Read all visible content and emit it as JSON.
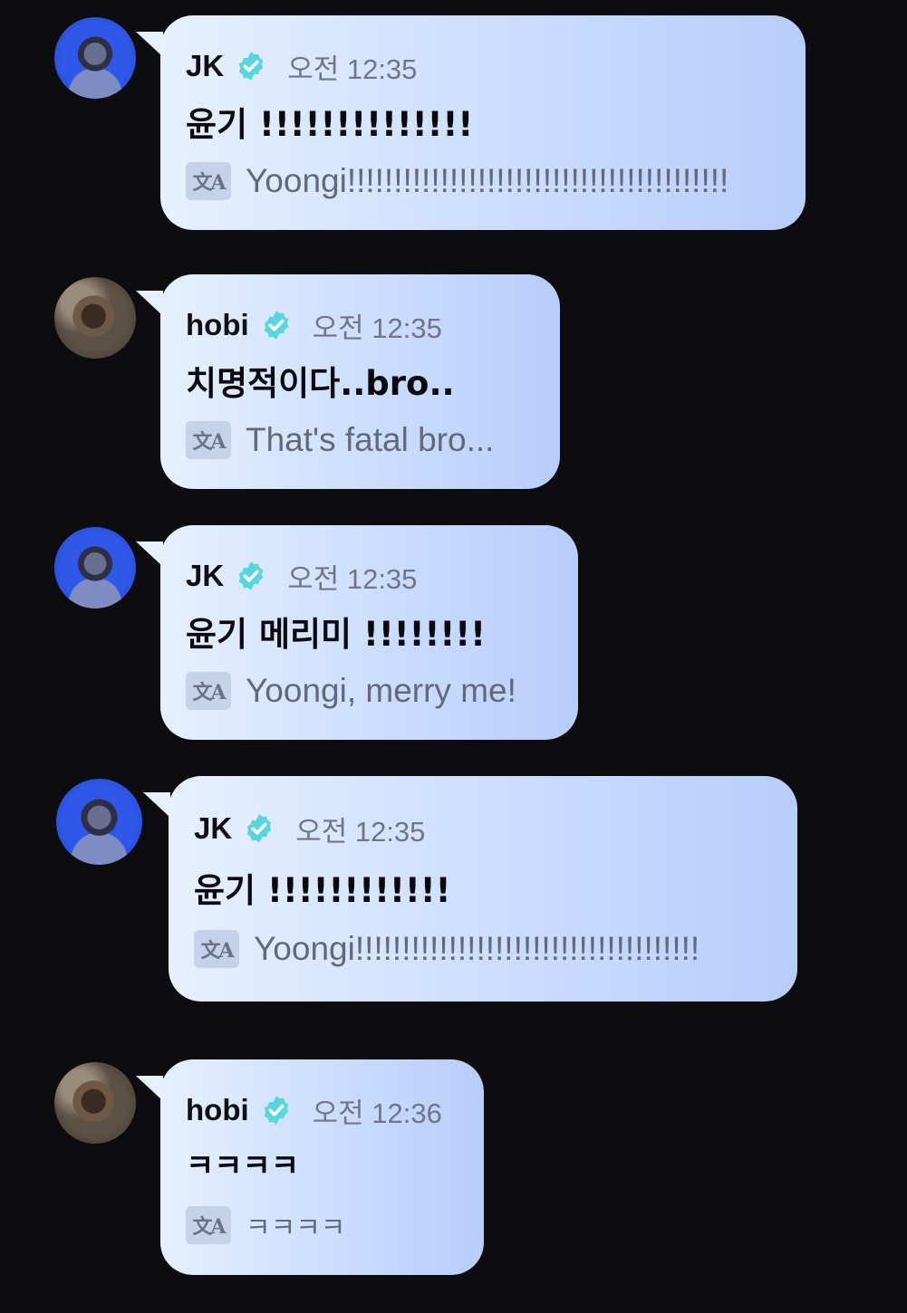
{
  "messages": [
    {
      "sender": "JK",
      "avatar": "jk-avatar",
      "verified_icon": "verified-badge-icon",
      "time": "오전 12:35",
      "text": "윤기 !!!!!!!!!!!!!!",
      "translation": "Yoongi!!!!!!!!!!!!!!!!!!!!!!!!!!!!!!!!!!!!!!!!!"
    },
    {
      "sender": "hobi",
      "avatar": "hobi-avatar",
      "verified_icon": "verified-badge-icon",
      "time": "오전 12:35",
      "text": "치명적이다..bro..",
      "translation": "That's fatal bro..."
    },
    {
      "sender": "JK",
      "avatar": "jk-avatar",
      "verified_icon": "verified-badge-icon",
      "time": "오전 12:35",
      "text": "윤기 메리미 !!!!!!!!",
      "translation": "Yoongi, merry me!"
    },
    {
      "sender": "JK",
      "avatar": "jk-avatar",
      "verified_icon": "verified-badge-icon",
      "time": "오전 12:35",
      "text": "윤기 !!!!!!!!!!!!",
      "translation": "Yoongi!!!!!!!!!!!!!!!!!!!!!!!!!!!!!!!!!!!!!"
    },
    {
      "sender": "hobi",
      "avatar": "hobi-avatar",
      "verified_icon": "verified-badge-icon",
      "time": "오전 12:36",
      "text": "ㅋㅋㅋㅋ",
      "translation": "ㅋㅋㅋㅋ"
    }
  ],
  "translate_icon_label": "文A",
  "colors": {
    "background": "#0d0d0f",
    "bubble_start": "#e6f0ff",
    "bubble_end": "#b8cdfc",
    "verified": "#57d7dd"
  }
}
